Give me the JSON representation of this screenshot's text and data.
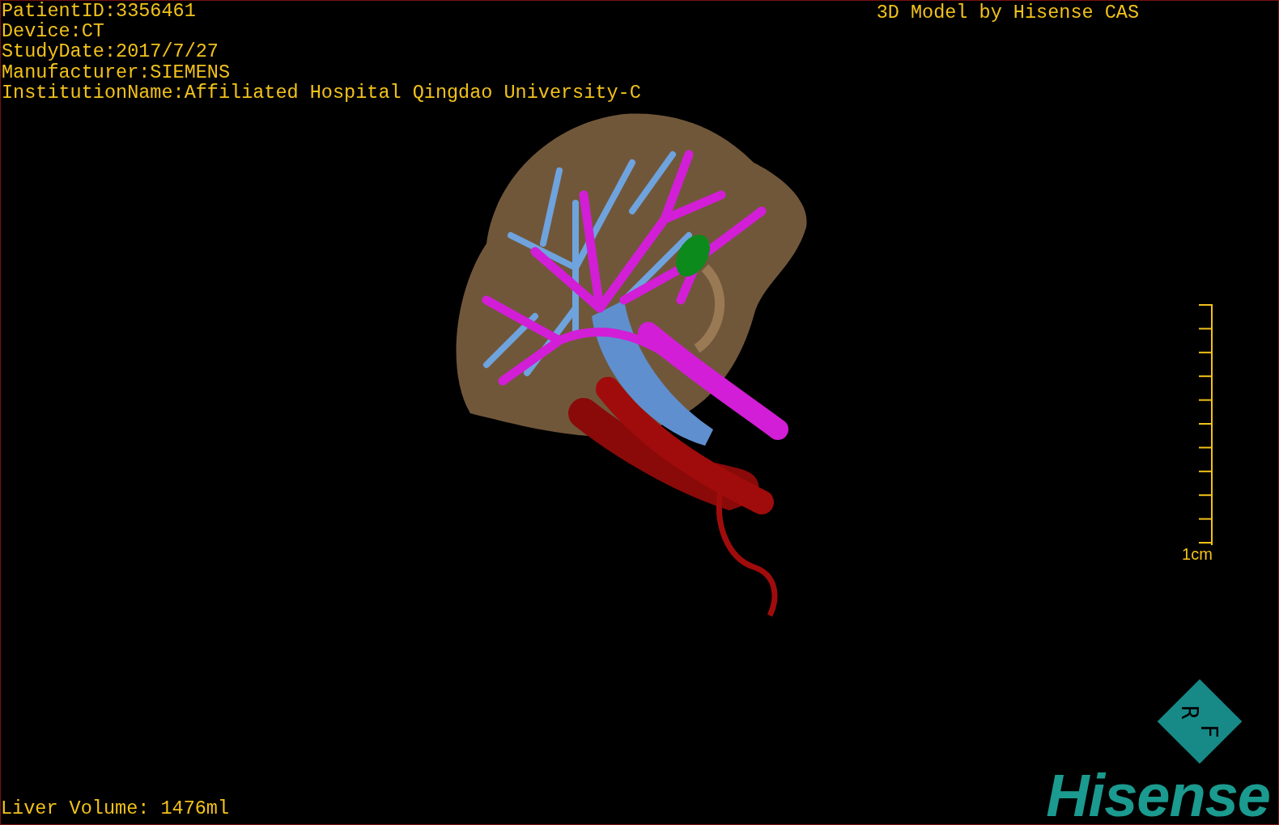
{
  "patient_info": [
    "PatientID:3356461",
    "Device:CT",
    "StudyDate:2017/7/27",
    "Manufacturer:SIEMENS",
    "InstitutionName:Affiliated Hospital Qingdao University-C"
  ],
  "title": "3D Model by Hisense CAS",
  "scale_bar": {
    "label": "1cm"
  },
  "liver_volume": "Liver Volume: 1476ml",
  "orientation_marker": [
    "R",
    "F"
  ],
  "logo": "Hisense"
}
